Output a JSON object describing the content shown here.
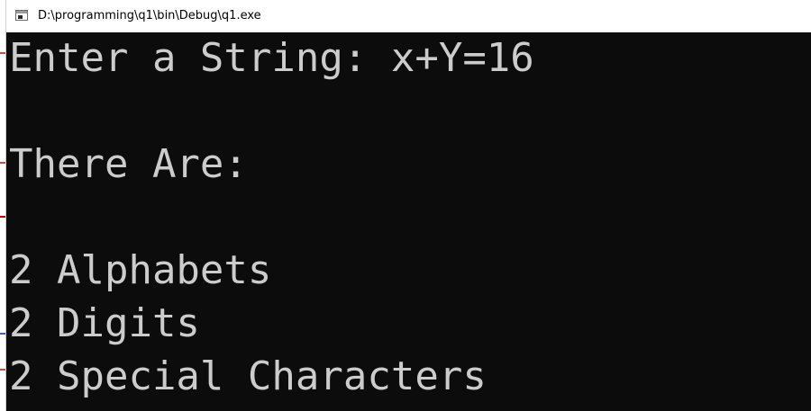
{
  "window": {
    "title": "D:\\programming\\q1\\bin\\Debug\\q1.exe",
    "icon": "console-window-icon"
  },
  "console": {
    "background": "#0c0c0c",
    "text_color": "#cccccc",
    "lines": [
      "Enter a String: x+Y=16",
      "",
      "There Are:",
      "",
      "2 Alphabets",
      "2 Digits",
      "2 Special Characters"
    ]
  }
}
